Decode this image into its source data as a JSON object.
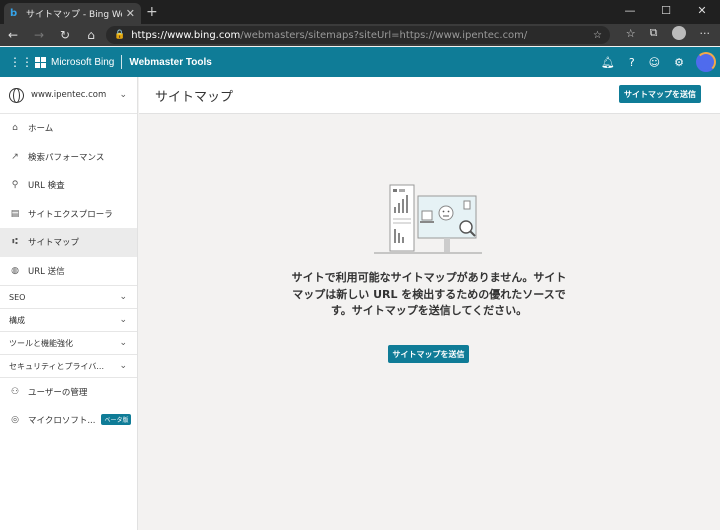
{
  "browser": {
    "tab_title": "サイトマップ - Bing Webmaster Tools",
    "url_domain": "https://www.bing.com",
    "url_path": "/webmasters/sitemaps?siteUrl=https://www.ipentec.com/"
  },
  "header": {
    "brand": "Microsoft Bing",
    "product": "Webmaster Tools"
  },
  "sidebar": {
    "site": "www.ipentec.com",
    "items": [
      {
        "label": "ホーム",
        "icon": "home-icon"
      },
      {
        "label": "検索パフォーマンス",
        "icon": "trend-icon"
      },
      {
        "label": "URL 検査",
        "icon": "search-icon"
      },
      {
        "label": "サイトエクスプローラ",
        "icon": "document-icon"
      },
      {
        "label": "サイトマップ",
        "icon": "sitemap-icon"
      },
      {
        "label": "URL 送信",
        "icon": "globe-icon"
      }
    ],
    "sections": [
      {
        "label": "SEO"
      },
      {
        "label": "構成"
      },
      {
        "label": "ツールと機能強化"
      },
      {
        "label": "セキュリティとプライバ..."
      }
    ],
    "bottom": [
      {
        "label": "ユーザーの管理",
        "icon": "user-manage-icon"
      },
      {
        "label": "マイクロソフト...",
        "icon": "fingerprint-icon",
        "badge": "ベータ版"
      }
    ]
  },
  "main": {
    "title": "サイトマップ",
    "submit_label": "サイトマップを送信",
    "empty_line1": "サイトで利用可能なサイトマップがありません。サイト",
    "empty_line2": "マップは新しい URL を検出するための優れたソースで",
    "empty_line3": "す。サイトマップを送信してください。",
    "center_submit_label": "サイトマップを送信"
  },
  "colors": {
    "accent": "#0f7c97"
  }
}
